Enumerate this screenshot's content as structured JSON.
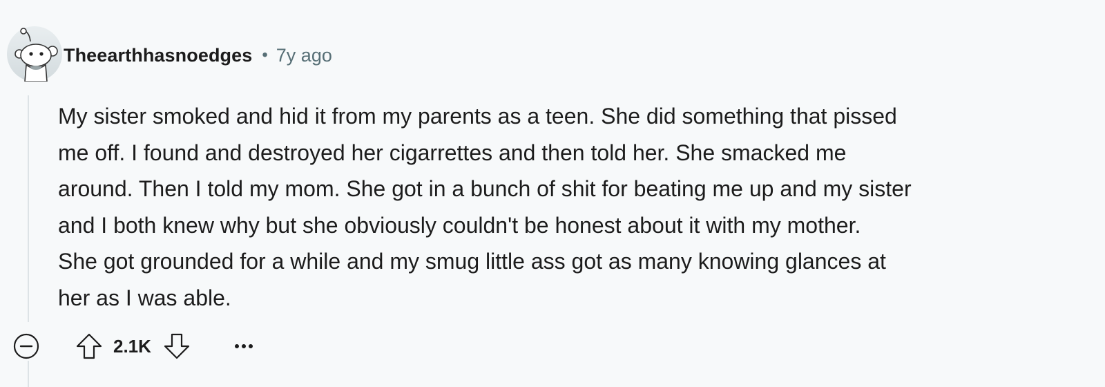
{
  "comment": {
    "author": "Theearthhasnoedges",
    "separator": "•",
    "age": "7y ago",
    "body_lines": [
      "My sister smoked and hid it from my parents as a teen. She did something that pissed",
      "me off. I found and destroyed her cigarrettes and then told her. She smacked me",
      "around. Then I told my mom. She got in a bunch of shit for beating me up and my sister",
      "and I both knew why but she obviously couldn't be honest about it with my mother.",
      "She got grounded for a while and my smug little ass got as many knowing glances at",
      "her as I was able."
    ],
    "score": "2.1K"
  },
  "icons": {
    "avatar": "snoo-avatar-icon",
    "collapse": "collapse-minus-icon",
    "upvote": "upvote-arrow-icon",
    "downvote": "downvote-arrow-icon",
    "more": "more-options-icon"
  },
  "colors": {
    "background": "#f7f9fa",
    "text": "#1c1c1c",
    "meta": "#576f76",
    "thread_line": "#dde3e6"
  }
}
